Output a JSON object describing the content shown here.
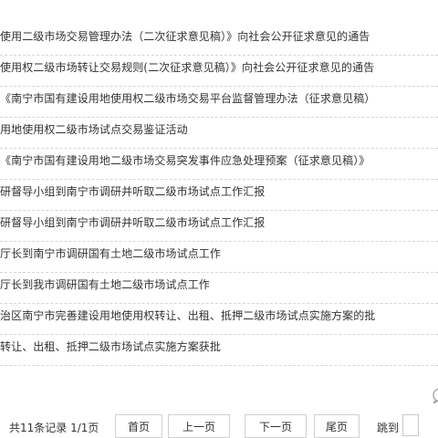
{
  "articles": [
    "使用二级市场交易管理办法（二次征求意见稿）》向社会公开征求意见的通告",
    "使用权二级市场转让交易规则(二次征求意见稿）》向社会公开征求意见的通告",
    "《南宁市国有建设用地使用权二级市场交易平台监督管理办法（征求意见稿）",
    "用地使用权二级市场试点交易鉴证活动",
    "《南宁市国有建设用地二级市场交易突发事件应急处理预案（征求意见稿）》",
    "研督导小组到南宁市调研并听取二级市场试点工作汇报",
    "研督导小组到南宁市调研并听取二级市场试点工作汇报",
    "厅长到南宁市调研国有土地二级市场试点工作",
    "厅长到我市调研国有土地二级市场试点工作",
    "治区南宁市完善建设用地使用权转让、出租、抵押二级市场试点实施方案的批",
    "转让、出租、抵押二级市场试点实施方案获批"
  ],
  "pagination": {
    "summary": "共11条记录 1/1页",
    "first": "首页",
    "prev": "上一页",
    "next": "下一页",
    "last": "尾页",
    "jump_label": "跳到",
    "jump_value": ""
  },
  "icons": {
    "side": "chat-bubble-icon"
  },
  "colors": {
    "text": "#333333",
    "divider": "#d6d6d6",
    "button_border": "#d0d0d0"
  }
}
